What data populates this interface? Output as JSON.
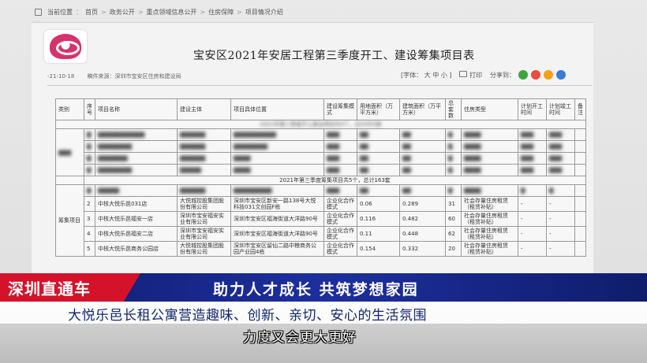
{
  "breadcrumb": [
    "当前位置",
    "首页",
    "政务公开",
    "重点领域信息公开",
    "住房保障",
    "项目情况介绍"
  ],
  "page": {
    "title": "宝安区2021年安居工程第三季度开工、建设筹集项目表",
    "date": "-21-10-18",
    "source": "稿件来源：深圳市宝安区住房和建设局",
    "font_size_label": "[字体：",
    "font_size_options": [
      "大",
      "中",
      "小"
    ],
    "font_size_close": "]",
    "print_label": "打印",
    "share_label": "分享到："
  },
  "table": {
    "headers": [
      "类别",
      "序号",
      "项目名称",
      "建设主体",
      "项目具体位置",
      "建设筹集模式",
      "用地面积（万平方米）",
      "建筑面积（万平方米）",
      "总套数",
      "住房类型",
      "计划开工时间",
      "计划竣工时间",
      "备注"
    ],
    "section1_title": "2021年第三季度开工建设项目共4个，总计955套",
    "section2_title": "2021年第三季度筹集项目共5个，总计163套",
    "category2": "筹集项目",
    "rows": [
      {
        "no": "2",
        "name": "中核大悦乐邑031店",
        "builder": "大悦城控股集团股份有限公司",
        "location": "深圳市宝安区新安一路138号大悦科技031文创园F栋",
        "mode": "企业化合作模式",
        "land": "0.06",
        "area": "0.289",
        "units": "31",
        "type": "社会存量住房租赁（租赁补贴）",
        "start": "-",
        "end": "-"
      },
      {
        "no": "3",
        "name": "中核大悦乐邑福安一店",
        "builder": "深圳市宝安福安实业有限公司",
        "location": "深圳市宝安区福海街道大洋路90号",
        "mode": "企业化合作模式",
        "land": "0.116",
        "area": "0.482",
        "units": "60",
        "type": "社会存量住房租赁（租赁补贴）",
        "start": "-",
        "end": "-"
      },
      {
        "no": "4",
        "name": "中核大悦乐邑福安二店",
        "builder": "深圳市宝安福安实业有限公司",
        "location": "深圳市宝安区福海街道大洋路90号",
        "mode": "企业化合作模式",
        "land": "0.11",
        "area": "0.448",
        "units": "62",
        "type": "社会存量住房租赁（租赁补贴）",
        "start": "-",
        "end": "-"
      },
      {
        "no": "5",
        "name": "中核大悦乐邑商务公园店",
        "builder": "大悦城控股集团股份有限公司",
        "location": "深圳市宝安区留仙二路中粮商务公园产业园4栋",
        "mode": "企业化合作模式",
        "land": "0.154",
        "area": "0.332",
        "units": "20",
        "type": "社会存量住房租赁（租赁补贴）",
        "start": "-",
        "end": "-"
      }
    ]
  },
  "overlay": {
    "program_tag": "深圳直通车",
    "headline": "助力人才成长 共筑梦想家园",
    "subline": "大悦乐邑长租公寓营造趣味、创新、亲切、安心的生活氛围",
    "caption": "力度又会更大更好"
  },
  "colors": {
    "brand_red": "#d4122a",
    "band_blue": "#1d2f9e",
    "logo_pink": "#d6336c"
  }
}
